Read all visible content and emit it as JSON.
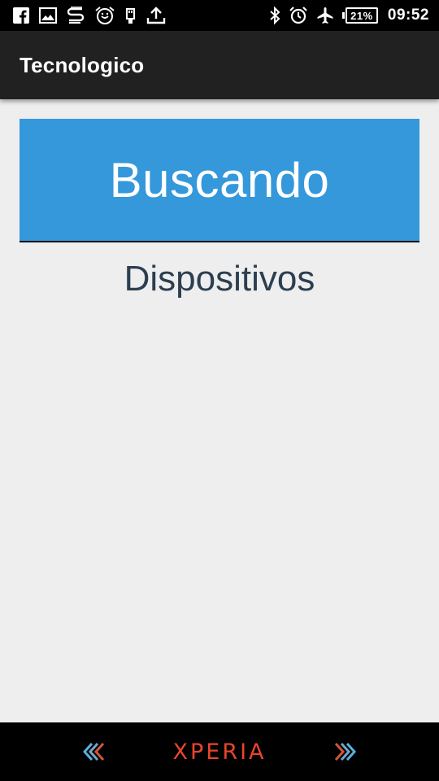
{
  "status_bar": {
    "left_icons": [
      "facebook-icon",
      "gallery-icon",
      "sync-app-icon",
      "alarm-clock-icon",
      "usb-icon",
      "upload-icon"
    ],
    "right_icons": [
      "bluetooth-icon",
      "alarm-icon",
      "airplane-icon"
    ],
    "battery_percent": "21%",
    "time": "09:52"
  },
  "app_bar": {
    "title": "Tecnologico",
    "background": "#212121"
  },
  "main": {
    "search_button_label": "Buscando",
    "search_button_color": "#3498db",
    "devices_label": "Dispositivos",
    "devices_label_color": "#2c3e50"
  },
  "nav_bar": {
    "back_icon": "back-chevrons-icon",
    "brand": "XPERIA",
    "brand_color": "#e8452c",
    "forward_icon": "forward-chevrons-icon"
  }
}
